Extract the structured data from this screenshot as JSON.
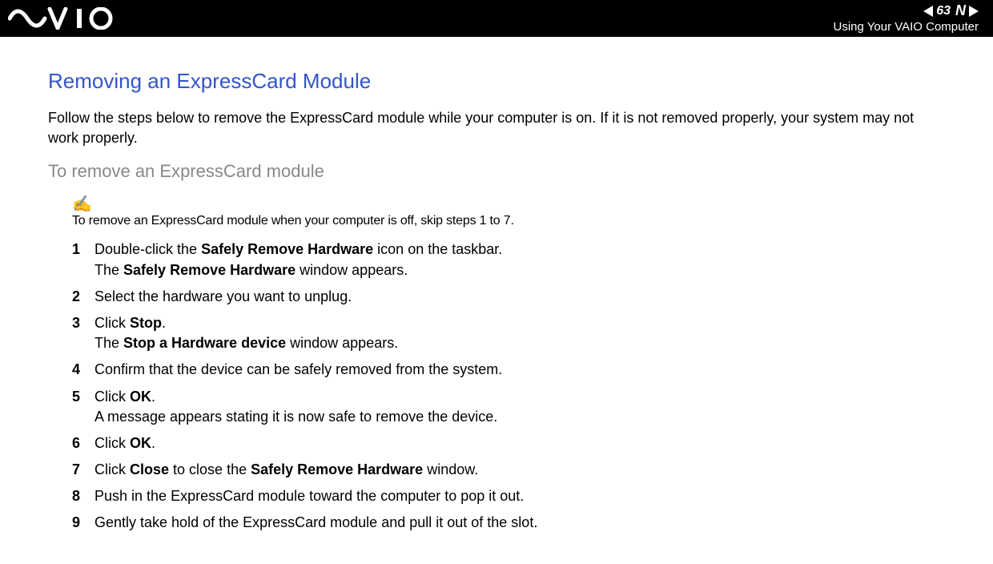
{
  "header": {
    "page_number": "63",
    "n_letter": "N",
    "subtitle": "Using Your VAIO Computer"
  },
  "main": {
    "title": "Removing an ExpressCard Module",
    "intro": "Follow the steps below to remove the ExpressCard module while your computer is on. If it is not removed properly, your system may not work properly.",
    "subheading": "To remove an ExpressCard module",
    "note_icon": "✍",
    "note_text": "To remove an ExpressCard module when your computer is off, skip steps 1 to 7.",
    "steps": [
      {
        "num": "1",
        "line1_pre": "Double-click the ",
        "line1_bold": "Safely Remove Hardware",
        "line1_post": " icon on the taskbar.",
        "line2_pre": "The ",
        "line2_bold": "Safely Remove Hardware",
        "line2_post": " window appears."
      },
      {
        "num": "2",
        "line1_pre": "Select the hardware you want to unplug.",
        "line1_bold": "",
        "line1_post": ""
      },
      {
        "num": "3",
        "line1_pre": "Click ",
        "line1_bold": "Stop",
        "line1_post": ".",
        "line2_pre": "The ",
        "line2_bold": "Stop a Hardware device",
        "line2_post": " window appears."
      },
      {
        "num": "4",
        "line1_pre": "Confirm that the device can be safely removed from the system.",
        "line1_bold": "",
        "line1_post": ""
      },
      {
        "num": "5",
        "line1_pre": "Click ",
        "line1_bold": "OK",
        "line1_post": ".",
        "line2_pre": "A message appears stating it is now safe to remove the device.",
        "line2_bold": "",
        "line2_post": ""
      },
      {
        "num": "6",
        "line1_pre": "Click ",
        "line1_bold": "OK",
        "line1_post": "."
      },
      {
        "num": "7",
        "line1_pre": "Click ",
        "line1_bold": "Close",
        "line1_post": " to close the ",
        "line1_bold2": "Safely Remove Hardware",
        "line1_post2": " window."
      },
      {
        "num": "8",
        "line1_pre": "Push in the ExpressCard module toward the computer to pop it out.",
        "line1_bold": "",
        "line1_post": ""
      },
      {
        "num": "9",
        "line1_pre": "Gently take hold of the ExpressCard module and pull it out of the slot.",
        "line1_bold": "",
        "line1_post": ""
      }
    ]
  }
}
